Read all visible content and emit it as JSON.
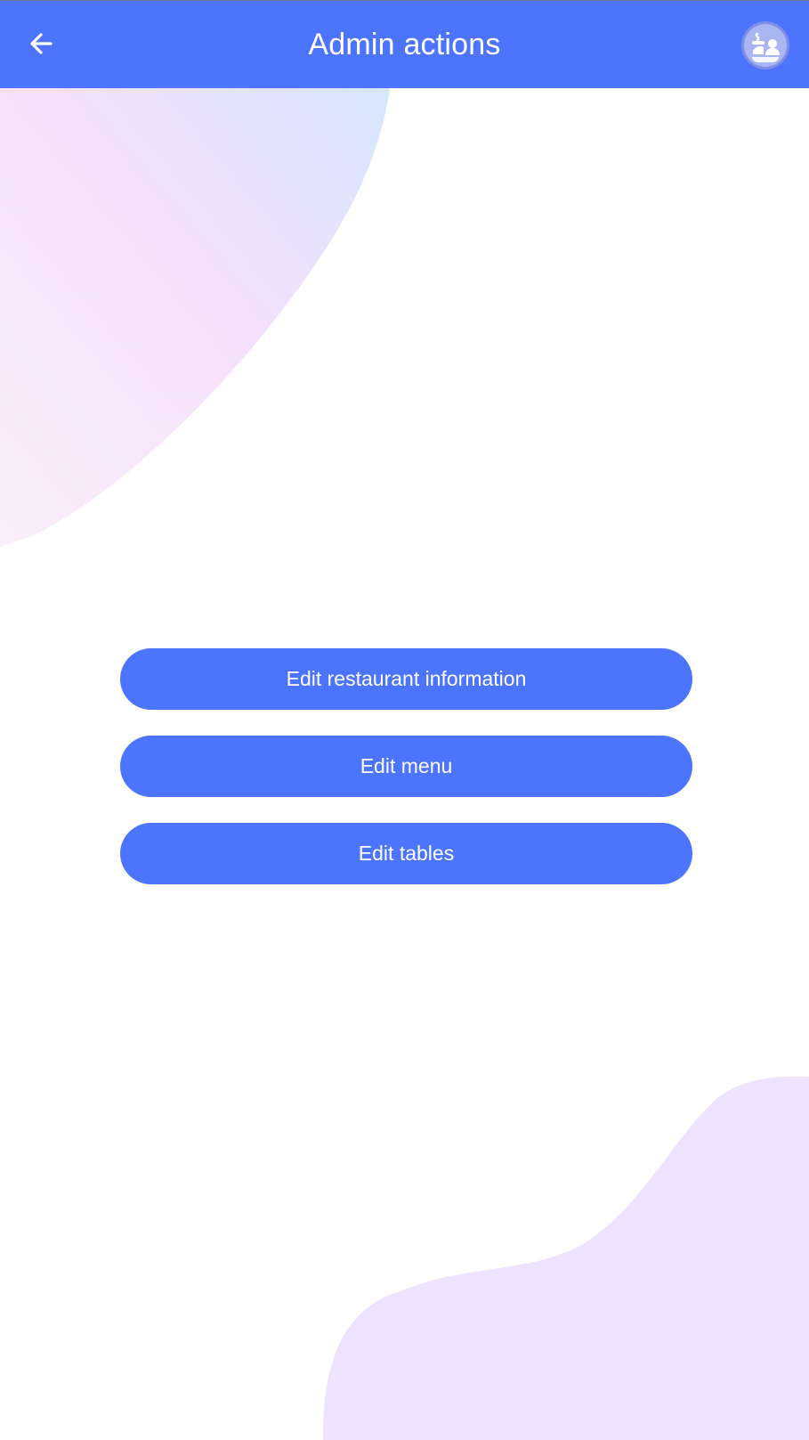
{
  "app_bar": {
    "title": "Admin actions",
    "back_icon": "arrow-left-icon",
    "avatar_icon": "restaurant-admin-avatar-icon",
    "background_color": "#4c74ff",
    "text_color": "#ffffff"
  },
  "actions": [
    {
      "label": "Edit restaurant information"
    },
    {
      "label": "Edit menu"
    },
    {
      "label": "Edit tables"
    }
  ],
  "theme": {
    "accent": "#4c74ff",
    "background": "#ffffff",
    "blob_top_left": [
      "#f8e0fa",
      "#d6e6ff"
    ],
    "blob_bottom_right": "#ede3fe"
  }
}
